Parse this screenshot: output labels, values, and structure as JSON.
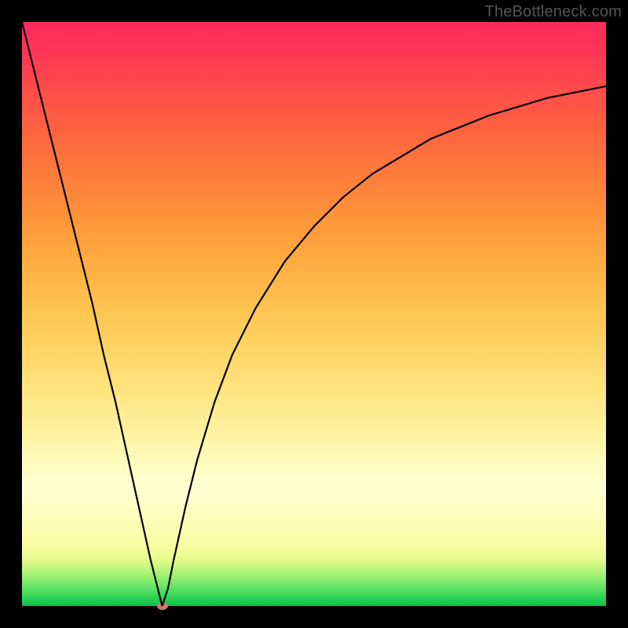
{
  "watermark": "TheBottleneck.com",
  "chart_data": {
    "type": "line",
    "title": "",
    "xlabel": "",
    "ylabel": "",
    "xlim": [
      0,
      100
    ],
    "ylim": [
      0,
      100
    ],
    "grid": false,
    "legend": false,
    "annotations": [],
    "marker": {
      "x": 24,
      "y": 0,
      "color": "#c9796f"
    },
    "background_gradient": {
      "top": "#fe2a5e",
      "middle": "#fecb58",
      "bottom": "#06c24a"
    },
    "series": [
      {
        "name": "curve",
        "x": [
          0,
          2,
          4,
          6,
          8,
          10,
          12,
          14,
          16,
          18,
          20,
          22,
          23,
          24,
          25,
          26,
          28,
          30,
          33,
          36,
          40,
          45,
          50,
          55,
          60,
          65,
          70,
          75,
          80,
          85,
          90,
          95,
          100
        ],
        "values": [
          100,
          92,
          84,
          76,
          68,
          60,
          52,
          43,
          35,
          26,
          17,
          8,
          4,
          0,
          3,
          8,
          17,
          25,
          35,
          43,
          51,
          59,
          65,
          70,
          74,
          77,
          80,
          82,
          84,
          85.5,
          87,
          88,
          89
        ]
      }
    ]
  }
}
